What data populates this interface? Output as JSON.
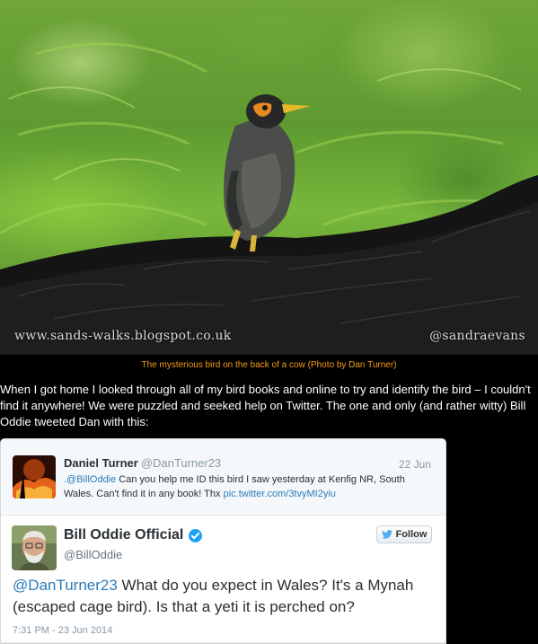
{
  "photo": {
    "watermark_left": "www.sands-walks.blogspot.co.uk",
    "watermark_right": "@sandraevans"
  },
  "caption": "The mysterious bird on the back of a cow (Photo by Dan Turner)",
  "intro": "When I got home I looked through all of my bird books and online to try and identify the bird – I couldn't find it anywhere! We were puzzled and seeked help on Twitter. The one and only (and rather witty) Bill Oddie tweeted Dan with this:",
  "quoted_tweet": {
    "name": "Daniel Turner",
    "handle": "@DanTurner23",
    "date": "22 Jun",
    "mention": ".@BillOddie",
    "text": " Can you help me ID this bird I saw yesterday at Kenfig NR, South Wales. Can't find it in any book! Thx ",
    "link": "pic.twitter.com/3tvyMI2yiu"
  },
  "tweet": {
    "name": "Bill Oddie Official",
    "handle": "@BillOddie",
    "follow_label": "Follow",
    "mention": "@DanTurner23",
    "text": "  What do  you expect in Wales? It's a Mynah (escaped cage bird). Is that a yeti it is perched on?",
    "timestamp": "7:31 PM - 23 Jun 2014",
    "verified_icon": "verified-badge-icon",
    "follow_icon": "twitter-bird-icon"
  },
  "colors": {
    "caption": "#f39c19",
    "link": "#2b7bb9",
    "verified": "#1da1f2"
  }
}
